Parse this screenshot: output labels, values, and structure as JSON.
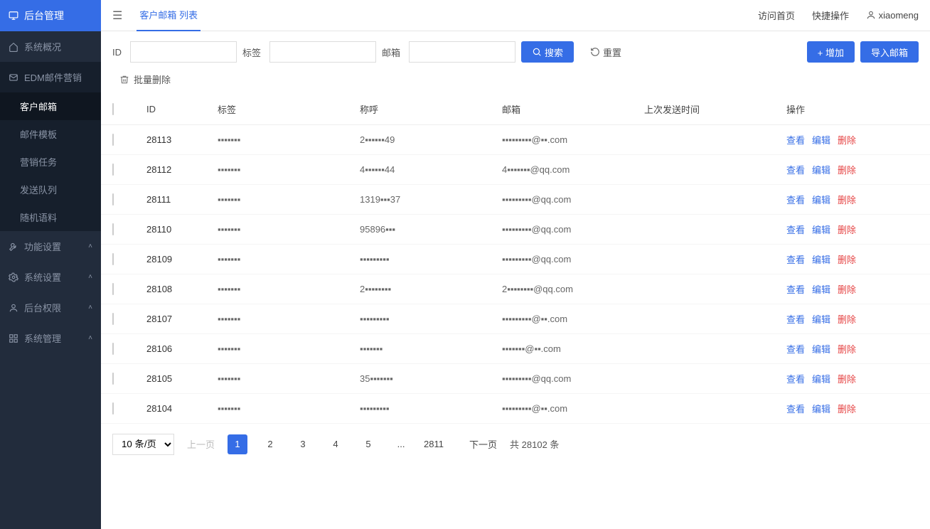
{
  "brand": "后台管理",
  "topbar": {
    "tab": "客户邮箱 列表",
    "right": {
      "home": "访问首页",
      "quick": "快捷操作",
      "user": "xiaomeng"
    }
  },
  "sidebar": {
    "items": [
      {
        "icon": "home",
        "label": "系统概况"
      },
      {
        "icon": "mail",
        "label": "EDM邮件营销",
        "expanded": true,
        "children": [
          {
            "label": "客户邮箱",
            "active": true
          },
          {
            "label": "邮件模板"
          },
          {
            "label": "营销任务"
          },
          {
            "label": "发送队列"
          },
          {
            "label": "随机语料"
          }
        ]
      },
      {
        "icon": "wrench",
        "label": "功能设置"
      },
      {
        "icon": "gear",
        "label": "系统设置"
      },
      {
        "icon": "user",
        "label": "后台权限"
      },
      {
        "icon": "grid",
        "label": "系统管理"
      }
    ]
  },
  "filters": {
    "id_label": "ID",
    "tag_label": "标签",
    "email_label": "邮箱",
    "search": "搜索",
    "reset": "重置",
    "add": "+ 增加",
    "import": "导入邮箱"
  },
  "bulk": {
    "delete": "批量删除"
  },
  "table": {
    "headers": {
      "id": "ID",
      "tag": "标签",
      "nick": "称呼",
      "email": "邮箱",
      "last": "上次发送时间",
      "ops": "操作"
    },
    "rows": [
      {
        "id": "28113",
        "tag": "▪▪▪▪▪▪▪",
        "nick": "2▪▪▪▪▪▪49",
        "email": "▪▪▪▪▪▪▪▪▪@▪▪.com",
        "last": ""
      },
      {
        "id": "28112",
        "tag": "▪▪▪▪▪▪▪",
        "nick": "4▪▪▪▪▪▪44",
        "email": "4▪▪▪▪▪▪▪@qq.com",
        "last": ""
      },
      {
        "id": "28111",
        "tag": "▪▪▪▪▪▪▪",
        "nick": "1319▪▪▪37",
        "email": "▪▪▪▪▪▪▪▪▪@qq.com",
        "last": ""
      },
      {
        "id": "28110",
        "tag": "▪▪▪▪▪▪▪",
        "nick": "95896▪▪▪",
        "email": "▪▪▪▪▪▪▪▪▪@qq.com",
        "last": ""
      },
      {
        "id": "28109",
        "tag": "▪▪▪▪▪▪▪",
        "nick": "▪▪▪▪▪▪▪▪▪",
        "email": "▪▪▪▪▪▪▪▪▪@qq.com",
        "last": ""
      },
      {
        "id": "28108",
        "tag": "▪▪▪▪▪▪▪",
        "nick": "2▪▪▪▪▪▪▪▪",
        "email": "2▪▪▪▪▪▪▪▪@qq.com",
        "last": ""
      },
      {
        "id": "28107",
        "tag": "▪▪▪▪▪▪▪",
        "nick": "▪▪▪▪▪▪▪▪▪",
        "email": "▪▪▪▪▪▪▪▪▪@▪▪.com",
        "last": ""
      },
      {
        "id": "28106",
        "tag": "▪▪▪▪▪▪▪",
        "nick": "▪▪▪▪▪▪▪",
        "nick2": "",
        "email": "▪▪▪▪▪▪▪@▪▪.com",
        "last": ""
      },
      {
        "id": "28105",
        "tag": "▪▪▪▪▪▪▪",
        "nick": "35▪▪▪▪▪▪▪",
        "email": "▪▪▪▪▪▪▪▪▪@qq.com",
        "last": ""
      },
      {
        "id": "28104",
        "tag": "▪▪▪▪▪▪▪",
        "nick": "▪▪▪▪▪▪▪▪▪",
        "email": "▪▪▪▪▪▪▪▪▪@▪▪.com",
        "last": ""
      }
    ],
    "ops": {
      "view": "查看",
      "edit": "编辑",
      "del": "删除"
    }
  },
  "pager": {
    "size": "10 条/页",
    "prev": "上一页",
    "pages": [
      "1",
      "2",
      "3",
      "4",
      "5",
      "...",
      "2811"
    ],
    "current": "1",
    "next": "下一页",
    "total": "共 28102 条"
  }
}
